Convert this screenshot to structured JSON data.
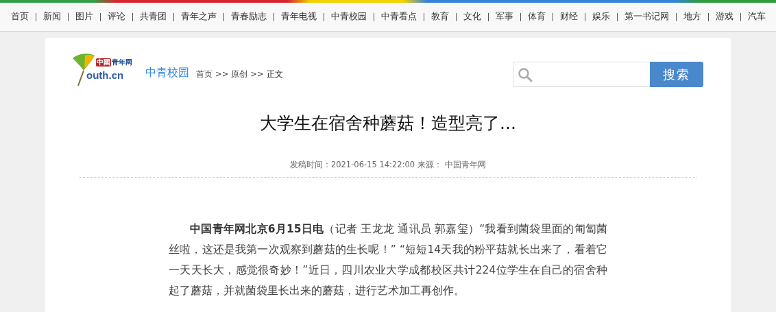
{
  "nav": [
    "首页",
    "新闻",
    "图片",
    "评论",
    "共青团",
    "青年之声",
    "青春励志",
    "青年电视",
    "中青校园",
    "中青看点",
    "教育",
    "文化",
    "军事",
    "体育",
    "财经",
    "娱乐",
    "第一书记网",
    "地方",
    "游戏",
    "汽车"
  ],
  "logo": {
    "badge": "中國",
    "name": "青年网",
    "domain": "outh.cn"
  },
  "channel": "中青校园",
  "breadcrumb": [
    {
      "label": "首页",
      "current": false
    },
    {
      "label": "原创",
      "current": false
    },
    {
      "label": "正文",
      "current": true
    }
  ],
  "breadcrumb_separator": ">>",
  "search": {
    "button": "搜索"
  },
  "article": {
    "title": "大学生在宿舍种蘑菇！造型亮了...",
    "meta_time": "发稿时间：2021-06-15 14:22:00",
    "meta_source_label": "来源：",
    "meta_source": "中国青年网",
    "paragraph": "**中国青年网北京6月15日电**（记者 王龙龙 通讯员 郭嘉玺）“我看到菌袋里面的匍匐菌丝啦，这还是我第一次观察到蘑菇的生长呢！” “短短14天我的粉平菇就长出来了，看着它一天天长大，感觉很奇妙！”近日，四川农业大学成都校区共计224位学生在自己的宿舍种起了蘑菇，并就菌袋里长出来的蘑菇，进行艺术加工再创作。"
  }
}
